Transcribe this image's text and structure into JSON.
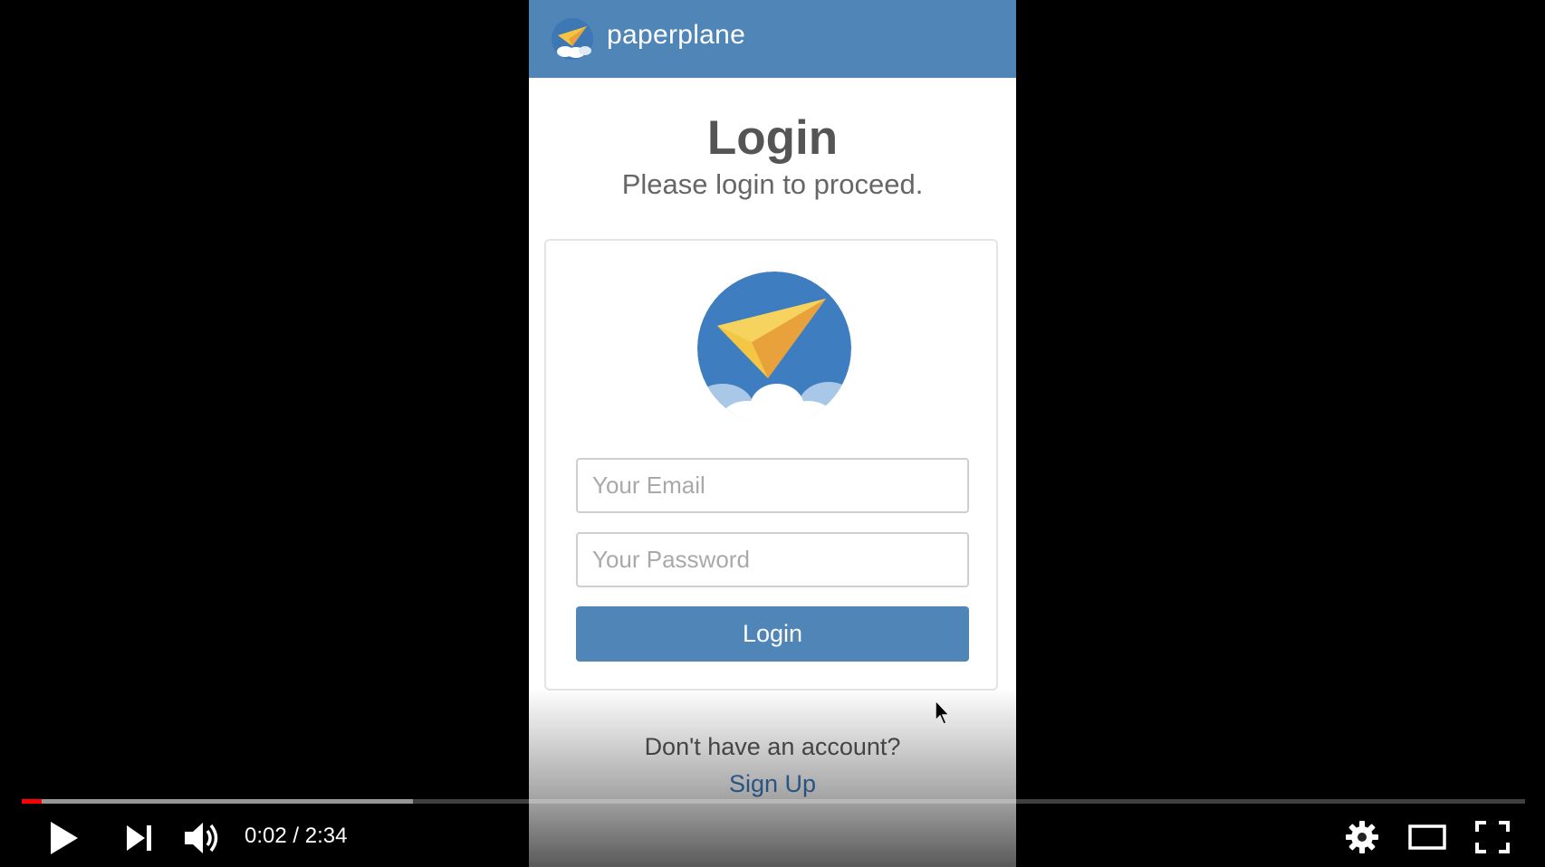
{
  "app": {
    "brand_name": "paperplane",
    "brand_color": "#4f85b7",
    "title": "Login",
    "subtitle": "Please login to proceed.",
    "email_placeholder": "Your Email",
    "password_placeholder": "Your Password",
    "login_button_label": "Login",
    "signup_prompt": "Don't have an account?",
    "signup_link": "Sign Up",
    "logo_icon": "paper-plane-icon"
  },
  "player": {
    "current_time": "0:02",
    "duration": "2:34",
    "time_display": "0:02 / 2:34",
    "played_fraction": 0.013,
    "buffered_fraction": 0.26,
    "played_color": "#ff0000",
    "icons": [
      "play-icon",
      "next-icon",
      "volume-icon",
      "settings-icon",
      "theater-mode-icon",
      "fullscreen-icon"
    ]
  }
}
